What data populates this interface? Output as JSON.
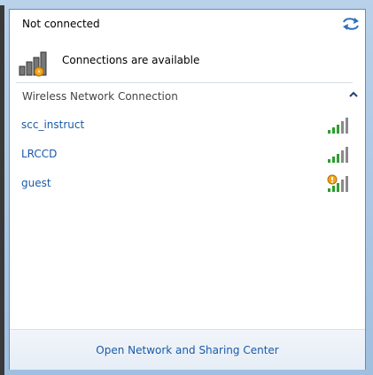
{
  "header": {
    "status": "Not connected",
    "refresh_icon": "refresh-icon"
  },
  "availability": {
    "text": "Connections are available",
    "icon": "network-available-icon"
  },
  "section": {
    "title": "Wireless Network Connection",
    "collapse_icon": "chevron-up-icon"
  },
  "networks": [
    {
      "name": "scc_instruct",
      "signal_icon": "signal-strength-icon",
      "secured": true
    },
    {
      "name": "LRCCD",
      "signal_icon": "signal-strength-icon",
      "secured": true
    },
    {
      "name": "guest",
      "signal_icon": "signal-strength-open-icon",
      "secured": false
    }
  ],
  "footer": {
    "link": "Open Network and Sharing Center"
  },
  "colors": {
    "link": "#1a5aa8",
    "panel_border": "#6f8aa8",
    "footer_bg": "#e6edf6",
    "signal_green": "#2e9e2e",
    "warning_orange": "#f2a51a"
  }
}
